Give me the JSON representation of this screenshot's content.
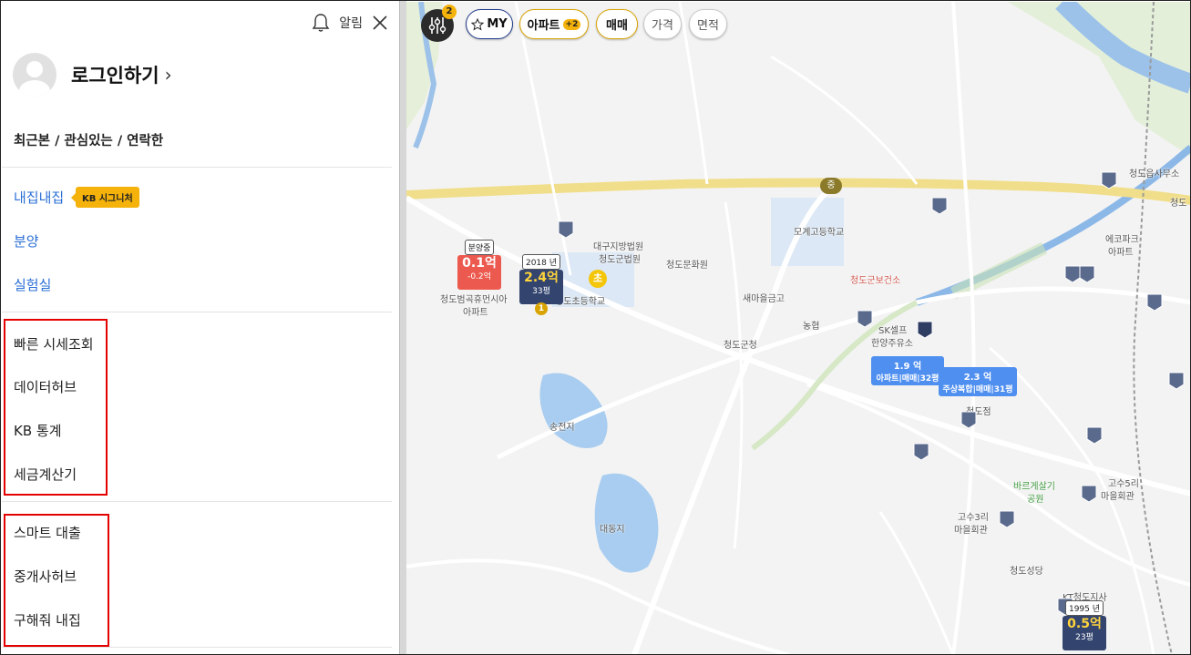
{
  "sidebar": {
    "alarm_label": "알림",
    "login_text": "로그인하기",
    "chevron": "›",
    "recent_label": "최근본 / 관심있는 / 연락한",
    "menu": [
      {
        "label": "내집내집",
        "badge": "KB 시그니처"
      },
      {
        "label": "분양"
      },
      {
        "label": "실험실"
      }
    ],
    "group1": [
      "빠른 시세조회",
      "데이터허브",
      "KB 통계",
      "세금계산기"
    ],
    "group2": [
      "스마트 대출",
      "중개사허브",
      "구해줘 내집"
    ]
  },
  "map_controls": {
    "filter_count": "2",
    "my_label": "MY",
    "apt_label": "아파트",
    "apt_badge": "+2",
    "sale_label": "매매",
    "price_label": "가격",
    "area_label": "면적"
  },
  "map_labels": [
    "대구지방법원",
    "청도군법원",
    "청도문화원",
    "모계고등학교",
    "청도범곡휴먼시아",
    "아파트",
    "청도초등학교",
    "새마을금고",
    "청도군보건소",
    "청도읍사무소",
    "에코파크",
    "아파트",
    "농협",
    "청도군청",
    "SK셀프",
    "한양주유소",
    "송전지",
    "대동지",
    "청도점",
    "바르게살기",
    "공원",
    "고수5리",
    "마을회관",
    "고수3리",
    "마을회관",
    "청도성당",
    "KT청도지사",
    "청도"
  ],
  "markers": {
    "red": {
      "tag": "분양중",
      "price": "0.1억",
      "sub": "-0.2억"
    },
    "navy1": {
      "tag": "2018 년",
      "price": "2.4억",
      "sub": "33평",
      "rank": "1"
    },
    "navy2": {
      "tag": "1995 년",
      "price": "0.5억",
      "sub": "23평"
    },
    "bubble1": {
      "price": "1.9 억",
      "sub": "아파트|매매|32평"
    },
    "bubble2": {
      "price": "2.3 억",
      "sub": "주상복합|매매|31평"
    },
    "school_badge": "초",
    "road_badge": "중"
  },
  "colors": {
    "accent_yellow": "#f4b20a",
    "link_blue": "#2a6fd6",
    "highlight_red": "#e40000",
    "marker_red": "#ec5a4f",
    "marker_navy": "#33456f",
    "bubble_blue": "#4f8ff0"
  }
}
